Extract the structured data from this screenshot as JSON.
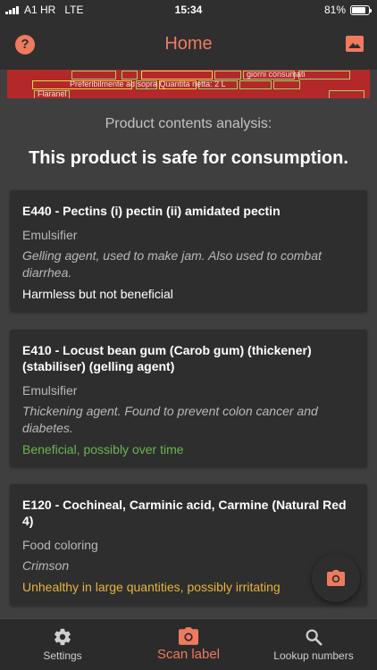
{
  "status_bar": {
    "carrier": "A1 HR",
    "network": "LTE",
    "time": "15:34",
    "battery": "81%",
    "battery_level": 0.81
  },
  "header": {
    "title": "Home",
    "help_icon": "help-circle-icon",
    "image_icon": "image-icon"
  },
  "scan_preview": {
    "line1": "giorni consumati",
    "line2": "Preferibilmente ad  sopra Quantita netta: 2 L",
    "line3": "Flaranel"
  },
  "summary": {
    "caption": "Product contents analysis:",
    "title": "This product is safe for consumption."
  },
  "additives": [
    {
      "code": "E440 - Pectins (i) pectin (ii) amidated pectin",
      "category": "Emulsifier",
      "description": "Gelling agent, used to make jam. Also used to combat diarrhea.",
      "verdict": "Harmless but not beneficial",
      "verdict_color": "#ffffff"
    },
    {
      "code": "E410 - Locust bean gum (Carob gum) (thickener) (stabiliser) (gelling agent)",
      "category": "Emulsifier",
      "description": "Thickening agent. Found to prevent colon cancer and diabetes.",
      "verdict": "Beneficial, possibly over time",
      "verdict_color": "#69b64f"
    },
    {
      "code": "E120 - Cochineal, Carminic acid, Carmine (Natural Red 4)",
      "category": "Food coloring",
      "description": "Crimson",
      "verdict": "Unhealthy in large quantities, possibly irritating",
      "verdict_color": "#e9b43a"
    }
  ],
  "fab": {
    "icon": "camera-icon"
  },
  "tabs": [
    {
      "label": "Settings",
      "icon": "gear-icon"
    },
    {
      "label": "Scan label",
      "icon": "camera-icon"
    },
    {
      "label": "Lookup numbers",
      "icon": "search-icon"
    }
  ],
  "colors": {
    "accent": "#f07a5e",
    "background": "#3f3f3f",
    "card": "#2e2e2e",
    "bar": "#2f2f2f"
  }
}
